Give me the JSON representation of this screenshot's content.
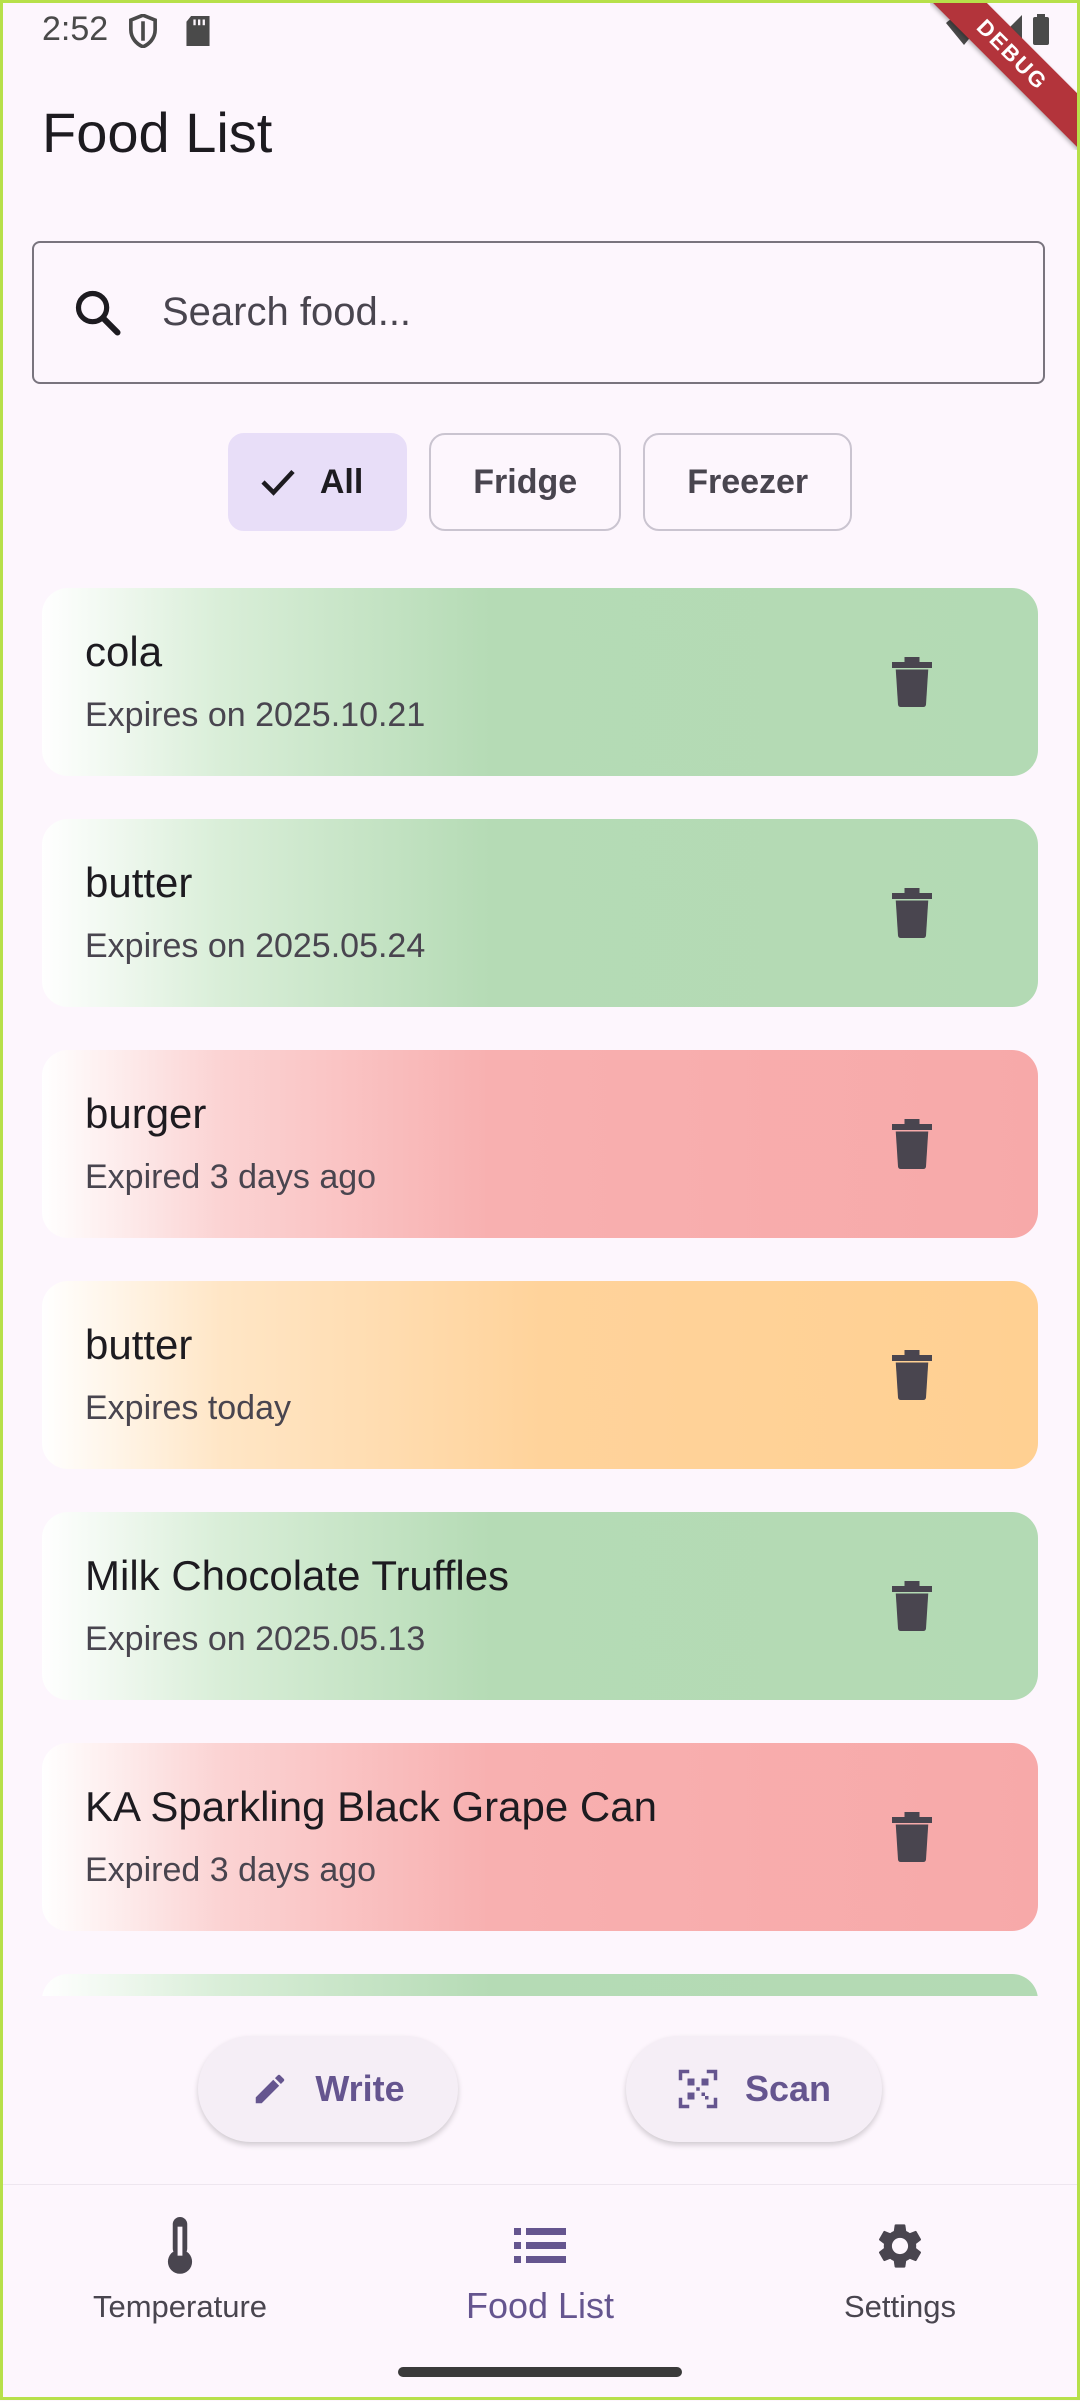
{
  "status_bar": {
    "time": "2:52"
  },
  "debug_banner": "DEBUG",
  "header": {
    "title": "Food List"
  },
  "search": {
    "placeholder": "Search food..."
  },
  "filters": [
    {
      "label": "All",
      "selected": true
    },
    {
      "label": "Fridge",
      "selected": false
    },
    {
      "label": "Freezer",
      "selected": false
    }
  ],
  "foods": [
    {
      "name": "cola",
      "status": "Expires on 2025.10.21",
      "state": "green"
    },
    {
      "name": "butter",
      "status": "Expires on 2025.05.24",
      "state": "green"
    },
    {
      "name": "burger",
      "status": "Expired 3 days ago",
      "state": "red"
    },
    {
      "name": "butter",
      "status": "Expires today",
      "state": "orange"
    },
    {
      "name": "Milk Chocolate Truffles",
      "status": "Expires on 2025.05.13",
      "state": "green"
    },
    {
      "name": "KA Sparkling Black Grape Can",
      "status": "Expired 3 days ago",
      "state": "red"
    },
    {
      "name": "",
      "status": "",
      "state": "green"
    }
  ],
  "actions": {
    "write_label": "Write",
    "scan_label": "Scan"
  },
  "nav": {
    "items": [
      {
        "label": "Temperature",
        "icon": "thermometer-icon",
        "active": false
      },
      {
        "label": "Food List",
        "icon": "list-icon",
        "active": true
      },
      {
        "label": "Settings",
        "icon": "gear-icon",
        "active": false
      }
    ]
  },
  "colors": {
    "accent": "#65558f",
    "selected_chip": "#e8def8",
    "fresh": "#b3dab4",
    "expired": "#f7a9a9",
    "today": "#ffd092",
    "background": "#fdf6fd"
  }
}
